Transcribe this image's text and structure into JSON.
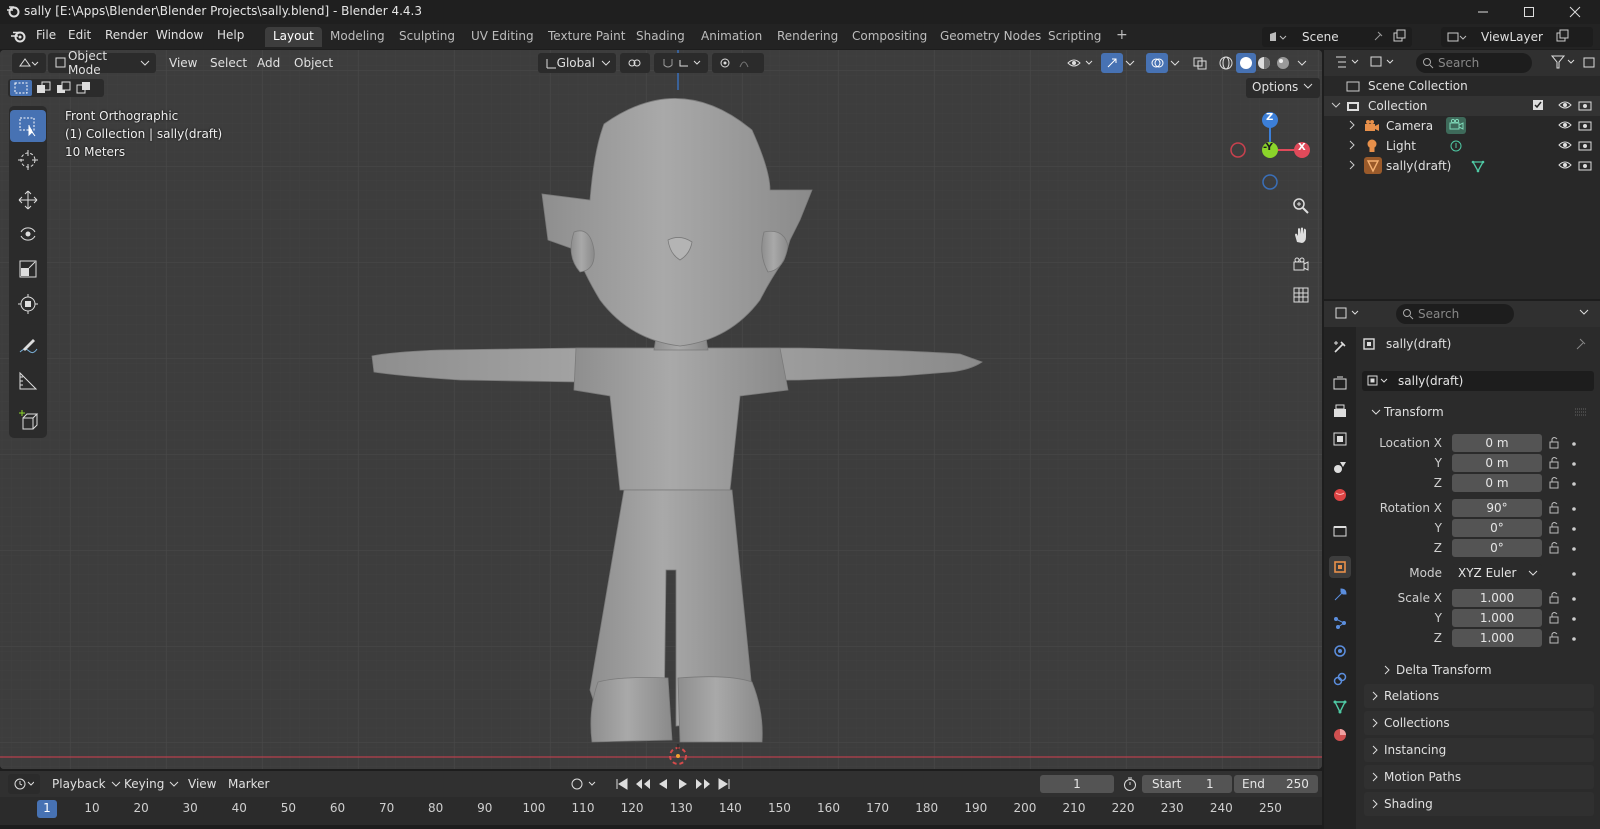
{
  "window": {
    "title": "sally [E:\\Apps\\Blender\\Blender Projects\\sally.blend] - Blender 4.4.3"
  },
  "menu": {
    "items": [
      "File",
      "Edit",
      "Render",
      "Window",
      "Help"
    ]
  },
  "workspaces": [
    "Layout",
    "Modeling",
    "Sculpting",
    "UV Editing",
    "Texture Paint",
    "Shading",
    "Animation",
    "Rendering",
    "Compositing",
    "Geometry Nodes",
    "Scripting"
  ],
  "workspace_add": "+",
  "scene": {
    "name": "Scene"
  },
  "view_layer": {
    "name": "ViewLayer"
  },
  "viewport": {
    "mode": "Object Mode",
    "menus": [
      "View",
      "Select",
      "Add",
      "Object"
    ],
    "transform_orientation": "Global",
    "options_label": "Options",
    "overlay_view": "Front Orthographic",
    "overlay_collection": "(1) Collection | sally(draft)",
    "overlay_scale": "10 Meters",
    "gizmo": {
      "z": "Z",
      "y": "-Y",
      "x": "X"
    }
  },
  "outliner": {
    "search_placeholder": "Search",
    "scene_collection": "Scene Collection",
    "collection": "Collection",
    "objects": [
      "Camera",
      "Light",
      "sally(draft)"
    ]
  },
  "properties": {
    "search_placeholder": "Search",
    "object_name": "sally(draft)",
    "data_name": "sally(draft)",
    "transform_label": "Transform",
    "location": {
      "label_x": "Location X",
      "label_y": "Y",
      "label_z": "Z",
      "x": "0 m",
      "y": "0 m",
      "z": "0 m"
    },
    "rotation": {
      "label_x": "Rotation X",
      "label_y": "Y",
      "label_z": "Z",
      "x": "90°",
      "y": "0°",
      "z": "0°"
    },
    "mode": {
      "label": "Mode",
      "value": "XYZ Euler"
    },
    "scale": {
      "label_x": "Scale X",
      "label_y": "Y",
      "label_z": "Z",
      "x": "1.000",
      "y": "1.000",
      "z": "1.000"
    },
    "delta_transform": "Delta Transform",
    "panels": [
      "Relations",
      "Collections",
      "Instancing",
      "Motion Paths",
      "Shading"
    ]
  },
  "timeline": {
    "menus": [
      "Playback",
      "Keying",
      "View",
      "Marker"
    ],
    "current_frame": "1",
    "start_label": "Start",
    "start": "1",
    "end_label": "End",
    "end": "250",
    "ticks": [
      "1",
      "10",
      "20",
      "30",
      "40",
      "50",
      "60",
      "70",
      "80",
      "90",
      "100",
      "110",
      "120",
      "130",
      "140",
      "150",
      "160",
      "170",
      "180",
      "190",
      "200",
      "210",
      "220",
      "230",
      "240",
      "250"
    ]
  },
  "colors": {
    "accent": "#4772b3",
    "axis_x": "#e04a5a",
    "axis_y": "#8bd42a",
    "axis_z": "#3c7fd8",
    "object_orange": "#e8904a"
  }
}
